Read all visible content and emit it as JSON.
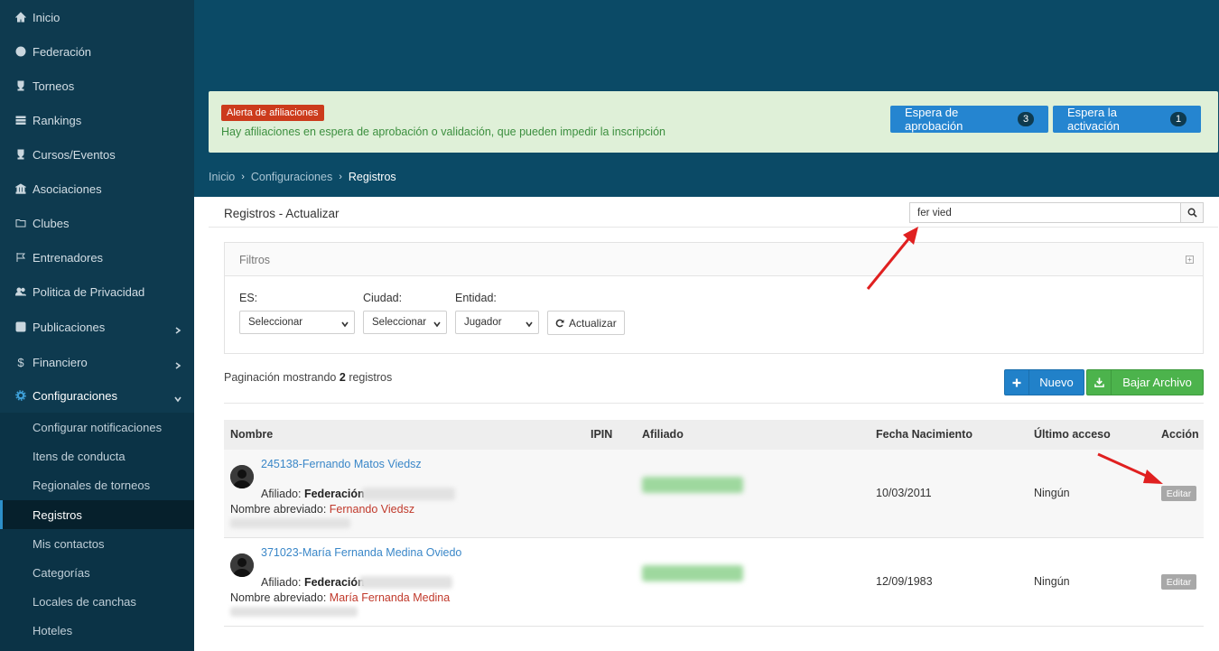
{
  "sidebar": {
    "items": [
      {
        "label": "Inicio",
        "icon": "home-icon"
      },
      {
        "label": "Federación",
        "icon": "globe-icon"
      },
      {
        "label": "Torneos",
        "icon": "trophy-icon"
      },
      {
        "label": "Rankings",
        "icon": "list-icon"
      },
      {
        "label": "Cursos/Eventos",
        "icon": "trophy-icon"
      },
      {
        "label": "Asociaciones",
        "icon": "bank-icon"
      },
      {
        "label": "Clubes",
        "icon": "folder-icon"
      },
      {
        "label": "Entrenadores",
        "icon": "flag-icon"
      },
      {
        "label": "Politica de Privacidad",
        "icon": "users-icon"
      },
      {
        "label": "Publicaciones",
        "icon": "edit-icon"
      },
      {
        "label": "Financiero",
        "icon": "dollar-icon"
      },
      {
        "label": "Configuraciones",
        "icon": "gear-icon"
      }
    ],
    "submenu": [
      "Configurar notificaciones",
      "Itens de conducta",
      "Regionales de torneos",
      "Registros",
      "Mis contactos",
      "Categorías",
      "Locales de canchas",
      "Hoteles"
    ]
  },
  "alert": {
    "badge": "Alerta de afiliaciones",
    "text": "Hay afiliaciones en espera de aprobación o validación, que pueden impedir la inscripción",
    "buttons": [
      {
        "label": "Espera de aprobación",
        "count": "3"
      },
      {
        "label": "Espera la activación",
        "count": "1"
      }
    ]
  },
  "breadcrumb": [
    "Inicio",
    "Configuraciones",
    "Registros"
  ],
  "card": {
    "title": "Registros - Actualizar",
    "search_value": "fer vied"
  },
  "filters": {
    "title": "Filtros",
    "labels": {
      "es": "ES:",
      "ciudad": "Ciudad:",
      "entidad": "Entidad:"
    },
    "values": {
      "es": "Seleccionar",
      "ciudad": "Seleccionar",
      "entidad": "Jugador"
    },
    "refresh": "Actualizar"
  },
  "pagination": {
    "prefix": "Paginación mostrando",
    "count": "2",
    "suffix": "registros"
  },
  "actions": {
    "new": "Nuevo",
    "download": "Bajar Archivo"
  },
  "table": {
    "headers": [
      "Nombre",
      "IPIN",
      "Afiliado",
      "Fecha Nacimiento",
      "Último acceso",
      "Acción"
    ],
    "rows": [
      {
        "name": "245138-Fernando Matos Viedsz",
        "aff_label": "Afiliado:",
        "aff_value": "Federación",
        "abbr_label": "Nombre abreviado:",
        "abbr_value": "Fernando Viedsz",
        "birth": "10/03/2011",
        "access": "Ningún",
        "action": "Editar"
      },
      {
        "name": "371023-María Fernanda Medina Oviedo",
        "aff_label": "Afiliado:",
        "aff_value": "Federación",
        "abbr_label": "Nombre abreviado:",
        "abbr_value": "María Fernanda Medina",
        "birth": "12/09/1983",
        "access": "Ningún",
        "action": "Editar"
      }
    ]
  },
  "colors": {
    "sidebar_bg": "#0e3a4f",
    "header_bg": "#0b4a66",
    "primary": "#2585d0",
    "success": "#4cb34c",
    "danger": "#cc3b1c",
    "annotation": "#e02020"
  }
}
